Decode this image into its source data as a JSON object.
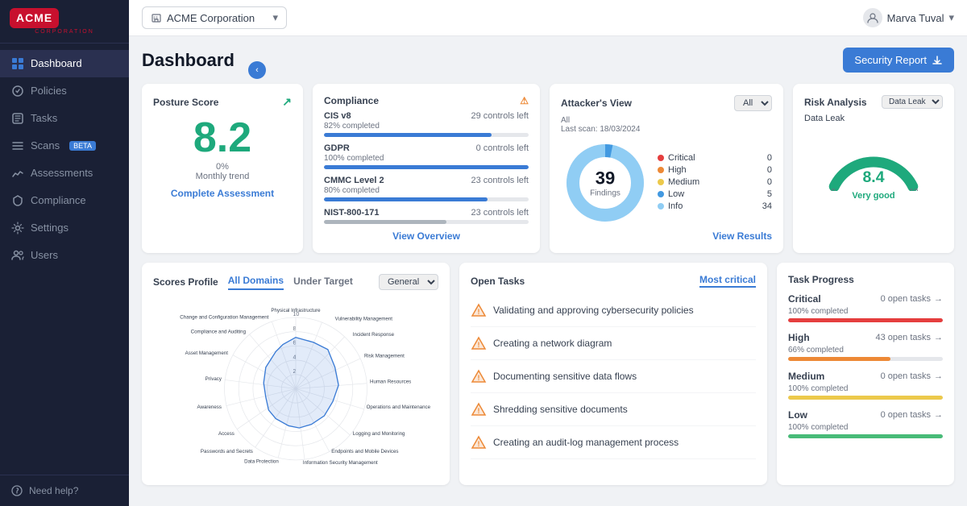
{
  "sidebar": {
    "logo": {
      "line1": "ACME",
      "line2": "CORPORATION"
    },
    "nav_items": [
      {
        "id": "dashboard",
        "label": "Dashboard",
        "active": true
      },
      {
        "id": "policies",
        "label": "Policies",
        "active": false
      },
      {
        "id": "tasks",
        "label": "Tasks",
        "active": false
      },
      {
        "id": "scans",
        "label": "Scans",
        "active": false,
        "badge": "BETA"
      },
      {
        "id": "assessments",
        "label": "Assessments",
        "active": false
      },
      {
        "id": "compliance",
        "label": "Compliance",
        "active": false
      },
      {
        "id": "settings",
        "label": "Settings",
        "active": false
      },
      {
        "id": "users",
        "label": "Users",
        "active": false
      }
    ],
    "need_help": "Need help?"
  },
  "topbar": {
    "company": "ACME Corporation",
    "user": "Marva Tuval"
  },
  "page": {
    "title": "Dashboard",
    "security_report_btn": "Security Report"
  },
  "posture_score": {
    "title": "Posture Score",
    "score": "8.2",
    "trend": "0%",
    "trend_label": "Monthly trend",
    "complete_btn": "Complete Assessment"
  },
  "compliance": {
    "title": "Compliance",
    "items": [
      {
        "name": "CIS v8",
        "controls_left": "29 controls left",
        "percent": 82,
        "sub": "82% completed",
        "color": "#3a7bd5"
      },
      {
        "name": "GDPR",
        "controls_left": "0 controls left",
        "percent": 100,
        "sub": "100% completed",
        "color": "#3a7bd5"
      },
      {
        "name": "CMMC Level 2",
        "controls_left": "23 controls left",
        "percent": 80,
        "sub": "80% completed",
        "color": "#3a7bd5"
      },
      {
        "name": "NIST-800-171",
        "controls_left": "23 controls left",
        "percent": 60,
        "sub": "",
        "color": "#3a7bd5"
      }
    ],
    "view_overview": "View Overview"
  },
  "attackers_view": {
    "title": "Attacker's View",
    "filter": "All",
    "scan_all": "All",
    "last_scan": "Last scan:",
    "last_scan_date": "18/03/2024",
    "findings": 39,
    "findings_label": "Findings",
    "legend": [
      {
        "label": "Critical",
        "value": 0,
        "color": "#e53e3e"
      },
      {
        "label": "High",
        "value": 0,
        "color": "#ed8936"
      },
      {
        "label": "Medium",
        "value": 0,
        "color": "#ecc94b"
      },
      {
        "label": "Low",
        "value": 5,
        "color": "#4299e1"
      },
      {
        "label": "Info",
        "value": 34,
        "color": "#90cdf4"
      }
    ],
    "view_results": "View Results"
  },
  "risk_analysis": {
    "title": "Risk Analysis",
    "filter": "Data Leak",
    "subtitle": "Data Leak",
    "score": "8.4",
    "label": "Very good",
    "scale_min": "0",
    "scale_max": "10"
  },
  "scores_profile": {
    "title": "Scores Profile",
    "tabs": [
      "All Domains",
      "Under Target"
    ],
    "active_tab": 0,
    "domain_filter": "General",
    "domains": [
      "Physical Infrastructure",
      "Vulnerability Management",
      "Incident Response",
      "Risk Management",
      "Human Resources",
      "Operations and Maintenance",
      "Logging and Monitoring",
      "Endpoints and Mobile Devices",
      "Information Security Management",
      "Data Protection",
      "Passwords and Secrets",
      "Access",
      "Awareness",
      "Privacy",
      "Asset Management",
      "Compliance and Auditing",
      "Change and Configuration Management"
    ]
  },
  "open_tasks": {
    "title": "Open Tasks",
    "filter": "Most critical",
    "tasks": [
      {
        "text": "Validating and approving cybersecurity policies"
      },
      {
        "text": "Creating a network diagram"
      },
      {
        "text": "Documenting sensitive data flows"
      },
      {
        "text": "Shredding sensitive documents"
      },
      {
        "text": "Creating an audit-log management process"
      }
    ]
  },
  "task_progress": {
    "title": "Task Progress",
    "items": [
      {
        "label": "Critical",
        "open": "0 open tasks",
        "sub": "100% completed",
        "percent": 100,
        "color": "#e53e3e"
      },
      {
        "label": "High",
        "open": "43 open tasks",
        "sub": "66% completed",
        "percent": 66,
        "color": "#ed8936"
      },
      {
        "label": "Medium",
        "open": "0 open tasks",
        "sub": "100% completed",
        "percent": 100,
        "color": "#ecc94b"
      },
      {
        "label": "Low",
        "open": "0 open tasks",
        "sub": "100% completed",
        "percent": 100,
        "color": "#48bb78"
      }
    ]
  }
}
